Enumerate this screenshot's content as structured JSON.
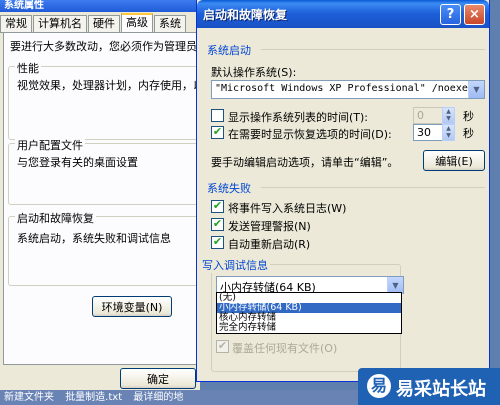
{
  "background_window": {
    "title": "系统属性",
    "tabs": [
      {
        "label": "常规",
        "active": false
      },
      {
        "label": "计算机名",
        "active": false
      },
      {
        "label": "硬件",
        "active": false
      },
      {
        "label": "高级",
        "active": true
      },
      {
        "label": "系统",
        "active": false
      }
    ],
    "notice": "要进行大多数改动，您必须作为管理员登录。",
    "groups": [
      {
        "title": "性能",
        "text": "视觉效果，处理器计划，内存使用，以及"
      },
      {
        "title": "用户配置文件",
        "text": "与您登录有关的桌面设置"
      },
      {
        "title": "启动和故障恢复",
        "text": "系统启动，系统失败和调试信息"
      }
    ],
    "env_button": "环境变量(N)",
    "ok_button": "确定"
  },
  "taskbar": {
    "items": [
      "新建文件夹",
      "批量制造.txt",
      "最详细的地"
    ]
  },
  "dialog": {
    "title": "启动和故障恢复",
    "help_label": "?",
    "close_label": "×",
    "system_startup": {
      "heading": "系统启动",
      "default_os_label": "默认操作系统(S):",
      "default_os_value": "\"Microsoft Windows XP Professional\" /noexecute=optin",
      "show_list": {
        "label": "显示操作系统列表的时间(T):",
        "checked": false,
        "value": "0",
        "unit": "秒"
      },
      "show_recovery": {
        "label": "在需要时显示恢复选项的时间(D):",
        "checked": true,
        "value": "30",
        "unit": "秒"
      },
      "edit_hint": "要手动编辑启动选项，请单击“编辑”。",
      "edit_button": "编辑(E)"
    },
    "system_failure": {
      "heading": "系统失败",
      "options": [
        {
          "label": "将事件写入系统日志(W)",
          "checked": true
        },
        {
          "label": "发送管理警报(N)",
          "checked": true
        },
        {
          "label": "自动重新启动(R)",
          "checked": true
        }
      ],
      "debug": {
        "heading": "写入调试信息",
        "selected": "小内存转储(64 KB)",
        "options": [
          "(无)",
          "小内存转储(64 KB)",
          "核心内存转储",
          "完全内存转储"
        ],
        "selected_index": 1,
        "overwrite": {
          "label": "覆盖任何现有文件(O)",
          "checked": true,
          "disabled": true
        }
      }
    }
  },
  "watermark": {
    "logo": "易",
    "text": "易采站长站"
  },
  "icons": {
    "dropdown": "chevron-down-icon",
    "check": "check-icon"
  }
}
